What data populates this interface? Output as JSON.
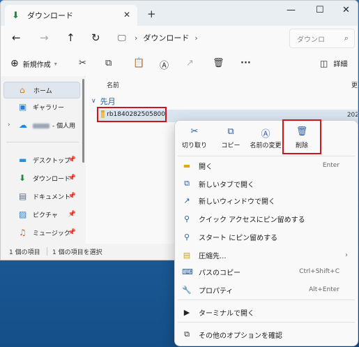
{
  "window": {
    "tab_title": "ダウンロード",
    "tab_close": "✕",
    "new_tab": "+",
    "minimize": "—",
    "maximize": "☐",
    "close": "✕"
  },
  "nav": {
    "back": "←",
    "forward": "→",
    "up": "↑",
    "refresh": "↻"
  },
  "address": {
    "separator": "›",
    "crumb": "ダウンロード",
    "search_placeholder": "ダウンロ"
  },
  "toolbar": {
    "new_label": "新規作成",
    "more": "···",
    "detail_label": "詳細"
  },
  "sidebar": {
    "items": [
      {
        "label": "ホーム",
        "icon": "home-icon"
      },
      {
        "label": "ギャラリー",
        "icon": "gallery-icon"
      },
      {
        "label": "- 個人用",
        "icon": "onedrive-icon"
      },
      {
        "label": "デスクトップ",
        "icon": "desktop-icon"
      },
      {
        "label": "ダウンロード",
        "icon": "download-icon"
      },
      {
        "label": "ドキュメント",
        "icon": "document-icon"
      },
      {
        "label": "ピクチャ",
        "icon": "pictures-icon"
      },
      {
        "label": "ミュージック",
        "icon": "music-icon"
      }
    ]
  },
  "main": {
    "column_name": "名前",
    "column_right": "更",
    "group_label": "先月",
    "file_name": "rb1840282505800",
    "file_date": "202"
  },
  "status": {
    "items": "1 個の項目",
    "selected": "1 個の項目を選択"
  },
  "context_menu": {
    "top_actions": [
      {
        "label": "切り取り",
        "icon": "cut-icon"
      },
      {
        "label": "コピー",
        "icon": "copy-icon"
      },
      {
        "label": "名前の変更",
        "icon": "rename-icon"
      },
      {
        "label": "削除",
        "icon": "delete-icon"
      }
    ],
    "items": [
      {
        "label": "開く",
        "shortcut": "Enter",
        "icon": "open-icon"
      },
      {
        "label": "新しいタブで開く",
        "shortcut": "",
        "icon": "new-tab-icon"
      },
      {
        "label": "新しいウィンドウで開く",
        "shortcut": "",
        "icon": "new-window-icon"
      },
      {
        "label": "クイック アクセスにピン留めする",
        "shortcut": "",
        "icon": "pin-icon"
      },
      {
        "label": "スタート にピン留めする",
        "shortcut": "",
        "icon": "pin-start-icon"
      },
      {
        "label": "圧縮先...",
        "shortcut": "",
        "icon": "zip-icon"
      },
      {
        "label": "パスのコピー",
        "shortcut": "Ctrl+Shift+C",
        "icon": "copy-path-icon"
      },
      {
        "label": "プロパティ",
        "shortcut": "Alt+Enter",
        "icon": "properties-icon"
      },
      {
        "label": "ターミナルで開く",
        "shortcut": "",
        "icon": "terminal-icon"
      },
      {
        "label": "その他のオプションを確認",
        "shortcut": "",
        "icon": "more-options-icon"
      }
    ]
  },
  "colors": {
    "highlight_border": "#d0141c",
    "accent": "#2a5d9f"
  }
}
